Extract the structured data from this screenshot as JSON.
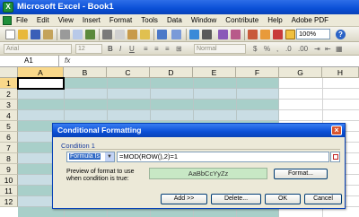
{
  "window": {
    "title": "Microsoft Excel - Book1",
    "app_icon": "X"
  },
  "menu": [
    "File",
    "Edit",
    "View",
    "Insert",
    "Format",
    "Tools",
    "Data",
    "Window",
    "Contribute",
    "Help",
    "Adobe PDF"
  ],
  "toolbar": {
    "zoom": "100%",
    "help": "?"
  },
  "formatting_toolbar": {
    "font": "Arial",
    "size": "12",
    "style": "Normal"
  },
  "formula_bar": {
    "name_box": "A1",
    "fx": "fx"
  },
  "grid": {
    "columns": [
      "A",
      "B",
      "C",
      "D",
      "E",
      "F",
      "G",
      "H"
    ],
    "rows": [
      "1",
      "2",
      "3",
      "4",
      "5",
      "6",
      "7",
      "8",
      "9",
      "10",
      "11",
      "12"
    ],
    "band_colors": {
      "odd": "#a8cfc9",
      "even": "#c9dde4"
    }
  },
  "dialog": {
    "title": "Conditional Formatting",
    "condition_label": "Condition",
    "condition_number": "1",
    "type_select": "Formula Is",
    "formula": "=MOD(ROW(),2)=1",
    "preview_label": "Preview of format to use when condition is true:",
    "preview_text": "AaBbCcYyZz",
    "format_button": "Format...",
    "add_button": "Add >>",
    "delete_button": "Delete...",
    "ok_button": "OK",
    "cancel_button": "Cancel"
  }
}
